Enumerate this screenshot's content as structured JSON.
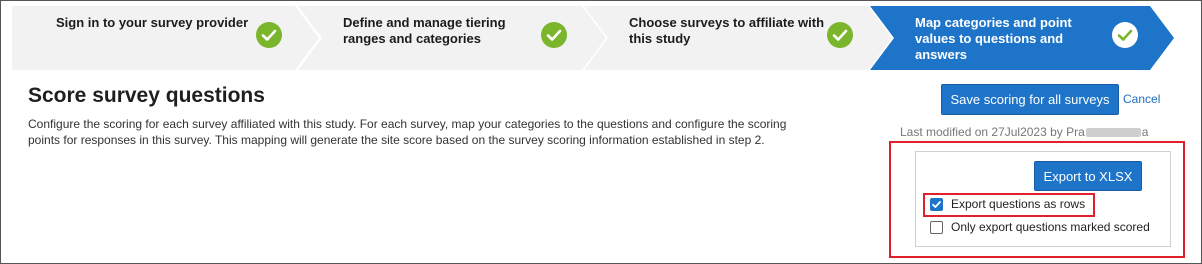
{
  "wizard": {
    "steps": [
      {
        "label": "Sign in to your survey provider",
        "status": "complete"
      },
      {
        "label": "Define and manage tiering ranges and categories",
        "status": "complete"
      },
      {
        "label": "Choose surveys to affiliate with this study",
        "status": "complete"
      },
      {
        "label": "Map categories and point values to questions and answers",
        "status": "active"
      }
    ]
  },
  "page": {
    "title": "Score survey questions",
    "description": "Configure the scoring for each survey affiliated with this study. For each survey, map your categories to the questions and configure the scoring points for responses in this survey. This mapping will generate the site score based on the survey scoring information established in step 2."
  },
  "actions": {
    "save_label": "Save scoring for all surveys",
    "cancel_label": "Cancel"
  },
  "last_modified": {
    "prefix": "Last modified on 27Jul2023 by Pra",
    "suffix": "a"
  },
  "export": {
    "button_label": "Export to XLSX",
    "options": [
      {
        "label": "Export questions as rows",
        "checked": true
      },
      {
        "label": "Only export questions marked scored",
        "checked": false
      }
    ]
  },
  "colors": {
    "accent": "#1d74c8",
    "step_bg": "#f2f2f2",
    "check_green": "#7ab52b",
    "highlight": "#e0202a"
  }
}
